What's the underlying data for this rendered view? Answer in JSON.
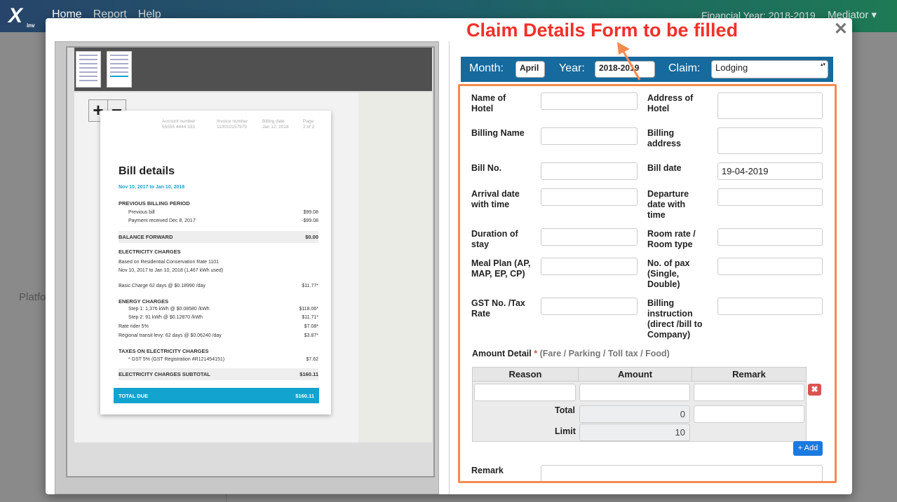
{
  "nav": {
    "logo_text": "X",
    "logo_sub": "inv",
    "links": [
      "Home",
      "Report",
      "Help"
    ],
    "financial_year": "Financial Year: 2018-2019",
    "user_label": "Mediator ▾"
  },
  "background": {
    "partial_text": "Platfo"
  },
  "modal": {
    "close_symbol": "✕",
    "annotation": "Claim Details Form to be filled"
  },
  "viewer": {
    "zoom_in": "+",
    "zoom_out": "−"
  },
  "bill": {
    "meta": [
      {
        "label": "Account number",
        "value": "55555 4444 333"
      },
      {
        "label": "Invoice number",
        "value": "110010157979"
      },
      {
        "label": "Billing date",
        "value": "Jan 12, 2018"
      },
      {
        "label": "Page",
        "value": "2 of 2"
      }
    ],
    "title": "Bill details",
    "period": "Nov 10, 2017 to Jan 10, 2018",
    "lines": [
      {
        "text": "PREVIOUS BILLING PERIOD",
        "amount": "",
        "style": "b"
      },
      {
        "text": "Previous bill",
        "amount": "$99.08",
        "style": "ind"
      },
      {
        "text": "Payment received Dec 8, 2017",
        "amount": "-$99.08",
        "style": "ind"
      },
      {
        "text": "BALANCE FORWARD",
        "amount": "$0.00",
        "style": "b shade"
      },
      {
        "text": "ELECTRICITY CHARGES",
        "amount": "",
        "style": "b"
      },
      {
        "text": "Based on Residential Conservation Rate 1101",
        "amount": "",
        "style": ""
      },
      {
        "text": "Nov 10, 2017 to Jan 10, 2018 (1,467 kWh used)",
        "amount": "",
        "style": ""
      },
      {
        "text": "Basic Charge  62 days @ $0.18990 /day",
        "amount": "$11.77*",
        "style": ""
      },
      {
        "text": "ENERGY CHARGES",
        "amount": "",
        "style": "b"
      },
      {
        "text": "Step 1:  1,376 kWh @ $0.08580 /kWh",
        "amount": "$118.06*",
        "style": "ind"
      },
      {
        "text": "Step 2:  91 kWh @ $0.12870 /kWh",
        "amount": "$11.71*",
        "style": "ind"
      },
      {
        "text": "Rate rider 5%",
        "amount": "$7.08*",
        "style": ""
      },
      {
        "text": "Regional transit levy: 62 days @ $0.06240 /day",
        "amount": "$3.87*",
        "style": ""
      },
      {
        "text": "TAXES ON ELECTRICITY CHARGES",
        "amount": "",
        "style": "b"
      },
      {
        "text": "* GST 5% (GST Registration #R121454151)",
        "amount": "$7.62",
        "style": "ind"
      },
      {
        "text": "ELECTRICITY CHARGES SUBTOTAL",
        "amount": "$160.11",
        "style": "b shade"
      }
    ],
    "total_label": "TOTAL DUE",
    "total_amount": "$160.11"
  },
  "form_header": {
    "month_label": "Month:",
    "month_value": "April",
    "year_label": "Year:",
    "year_value": "2018-2019",
    "claim_label": "Claim:",
    "claim_value": "Lodging"
  },
  "fields": {
    "name_of_hotel": {
      "label": "Name of Hotel",
      "value": ""
    },
    "address_of_hotel": {
      "label": "Address of Hotel",
      "value": ""
    },
    "billing_name": {
      "label": "Billing Name",
      "value": ""
    },
    "billing_address": {
      "label": "Billing address",
      "value": ""
    },
    "bill_no": {
      "label": "Bill No.",
      "value": ""
    },
    "bill_date": {
      "label": "Bill date",
      "value": "19-04-2019"
    },
    "arrival": {
      "label": "Arrival date with time",
      "value": ""
    },
    "departure": {
      "label": "Departure date with time",
      "value": ""
    },
    "duration": {
      "label": "Duration of stay",
      "value": ""
    },
    "room_rate": {
      "label": "Room rate / Room type",
      "value": ""
    },
    "meal_plan": {
      "label": "Meal Plan (AP, MAP, EP, CP)",
      "value": ""
    },
    "pax": {
      "label": "No. of pax (Single, Double)",
      "value": ""
    },
    "gst": {
      "label": "GST No. /Tax Rate",
      "value": ""
    },
    "billing_instruction": {
      "label": "Billing instruction (direct /bill to Company)",
      "value": ""
    }
  },
  "amount_detail": {
    "title": "Amount Detail",
    "required": "*",
    "hint": "(Fare / Parking / Toll tax / Food)",
    "columns": [
      "Reason",
      "Amount",
      "Remark"
    ],
    "total_label": "Total",
    "total_value": "0",
    "limit_label": "Limit",
    "limit_value": "10",
    "delete_symbol": "✖",
    "add_label": "+ Add"
  },
  "remark": {
    "label": "Remark",
    "value": ""
  },
  "colors": {
    "annotation": "#f0312a",
    "highlight_border": "#f58a4f",
    "header_bar": "#166a9e",
    "add_button": "#1a7ae0",
    "delete_button": "#d9534f"
  }
}
